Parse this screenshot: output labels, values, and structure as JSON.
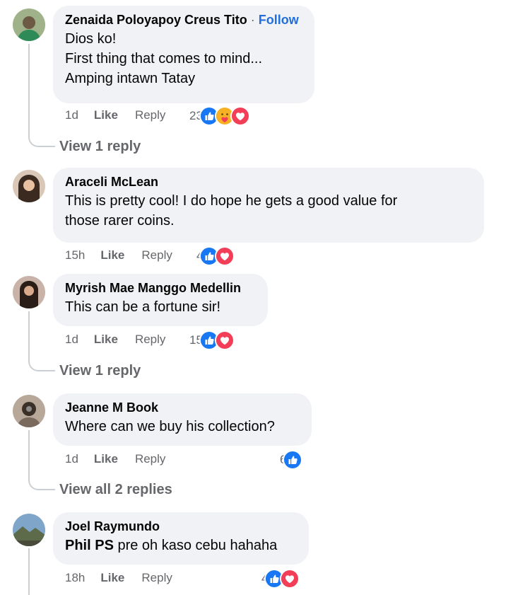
{
  "comments": [
    {
      "author": "Zenaida Poloyapoy Creus Tito",
      "follow": "Follow",
      "lines": [
        "Dios ko!",
        "First thing that comes to mind...",
        "Amping intawn Tatay"
      ],
      "time": "1d",
      "like": "Like",
      "reply": "Reply",
      "reaction_count": "23",
      "reactions": [
        "like-icon",
        "care-icon",
        "love-icon"
      ],
      "view_replies": "View 1 reply"
    },
    {
      "author": "Araceli McLean",
      "lines": [
        "This is pretty cool! I do hope he gets a good value for",
        "those rarer coins."
      ],
      "time": "15h",
      "like": "Like",
      "reply": "Reply",
      "reaction_count": "4",
      "reactions": [
        "like-icon",
        "love-icon"
      ]
    },
    {
      "author": "Myrish Mae Manggo Medellin",
      "lines": [
        "This can be a fortune sir!"
      ],
      "time": "1d",
      "like": "Like",
      "reply": "Reply",
      "reaction_count": "15",
      "reactions": [
        "like-icon",
        "love-icon"
      ],
      "view_replies": "View 1 reply"
    },
    {
      "author": "Jeanne M Book",
      "lines": [
        "Where can we buy his collection?"
      ],
      "time": "1d",
      "like": "Like",
      "reply": "Reply",
      "reaction_count": "6",
      "reactions": [
        "like-icon"
      ],
      "view_replies": "View all 2 replies"
    },
    {
      "author": "Joel Raymundo",
      "mention": "Phil PS",
      "lines": [
        " pre oh kaso cebu hahaha"
      ],
      "time": "18h",
      "like": "Like",
      "reply": "Reply",
      "reaction_count": "4",
      "reactions": [
        "like-icon",
        "love-icon"
      ]
    }
  ],
  "colors": {
    "like": "#1877f2",
    "love": "#f33e58",
    "care": "#f7b125",
    "bubble": "#f0f2f5",
    "follow": "#216fdb"
  },
  "separator": "·"
}
